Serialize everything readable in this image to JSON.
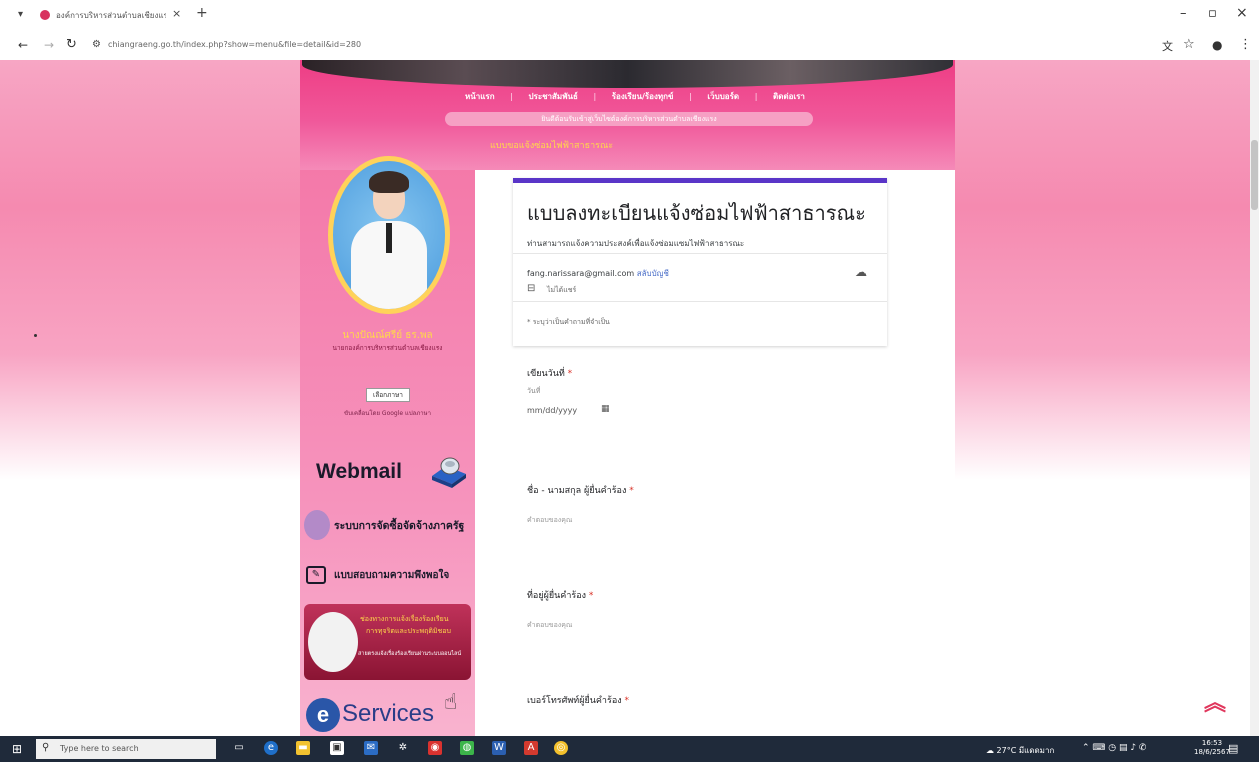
{
  "browser": {
    "tab_title": "องค์การบริหารส่วนตำบลเชียงแรง",
    "url": "chiangraeng.go.th/index.php?show=menu&file=detail&id=280"
  },
  "site": {
    "nav": [
      "หน้าแรก",
      "ประชาสัมพันธ์",
      "ร้องเรียน/ร้องทุกข์",
      "เว็บบอร์ด",
      "ติดต่อเรา"
    ],
    "marquee": "ยินดีต้อนรับเข้าสู่เว็บไซต์องค์การบริหารส่วนตำบลเชียงแรง",
    "section_title": "แบบขอแจ้งซ่อมไฟฟ้าสาธารณะ"
  },
  "sidebar": {
    "name": "นางปัณณ์ศรีย์ ธร.พล",
    "role": "นายกองค์การบริหารส่วนตำบลเชียงแรง",
    "lang_button": "เลือกภาษา",
    "lang_note": "ขับเคลื่อนโดย Google แปลภาษา",
    "webmail": "Webmail",
    "egp": "ระบบการจัดซื้อจัดจ้างภาครัฐ",
    "survey": "แบบสอบถามความพึงพอใจ",
    "complaint_line1": "ช่องทางการแจ้งเรื่องร้องเรียน",
    "complaint_line2": "การทุจริตและประพฤติมิชอบ",
    "complaint_line3": "สายตรงแจ้งเรื่องร้องเรียนผ่านระบบออนไลน์",
    "eservices_letter": "e",
    "eservices": "Services"
  },
  "form": {
    "title": "แบบลงทะเบียนแจ้งซ่อมไฟฟ้าสาธารณะ",
    "description": "ท่านสามารถแจ้งความประสงค์เพื่อแจ้งซ่อมแซมไฟฟ้าสาธารณะ",
    "email": "fang.narissara@gmail.com",
    "switch_account": "สลับบัญชี",
    "not_shared": "ไม่ได้แชร์",
    "required_note": "* ระบุว่าเป็นคำถามที่จำเป็น",
    "q1_label": "เขียนวันที่",
    "q1_sub": "วันที่",
    "q1_placeholder": "mm/dd/yyyy",
    "q2_label": "ชื่อ - นามสกุล ผู้ยื่นคำร้อง",
    "q2_placeholder": "คำตอบของคุณ",
    "q3_label": "ที่อยู่ผู้ยื่นคำร้อง",
    "q3_placeholder": "คำตอบของคุณ",
    "q4_label": "เบอร์โทรศัพท์ผู้ยื่นคำร้อง"
  },
  "taskbar": {
    "search_placeholder": "Type here to search",
    "weather": "27°C มีแดดมาก",
    "time": "16:53",
    "date": "18/6/2567"
  },
  "colors": {
    "accent_pink": "#f0589a",
    "form_header": "#5a35c8",
    "required": "#d93025"
  }
}
